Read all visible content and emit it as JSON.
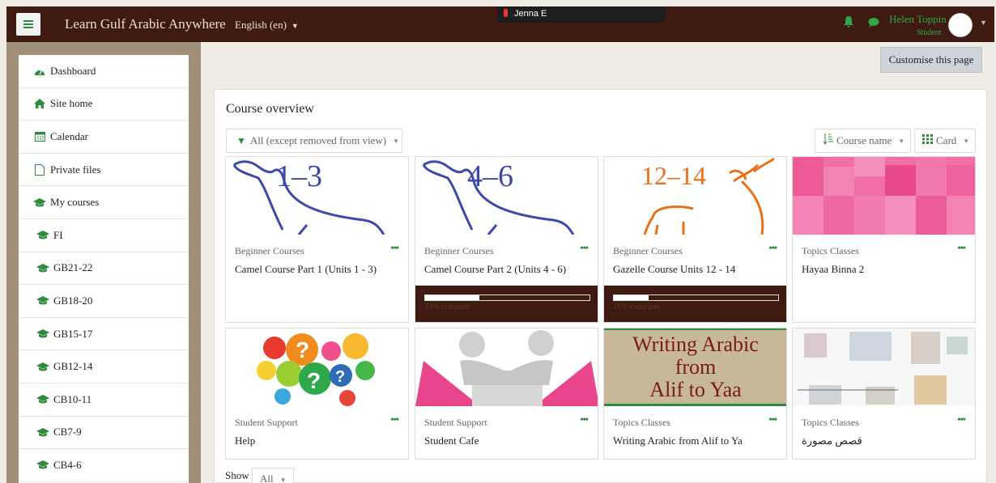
{
  "topbar": {
    "site_title": "Learn Gulf Arabic Anywhere",
    "language": "English (en)",
    "zoom_participant": "Jenna E",
    "user_name": "Helen Toppin",
    "user_role": "Student",
    "icons": [
      "menu-icon",
      "bell-icon",
      "chat-icon",
      "avatar",
      "chevron-down-icon"
    ]
  },
  "nav": {
    "items": [
      {
        "label": "Dashboard",
        "icon": "dashboard-icon"
      },
      {
        "label": "Site home",
        "icon": "home-icon"
      },
      {
        "label": "Calendar",
        "icon": "calendar-icon"
      },
      {
        "label": "Private files",
        "icon": "file-icon"
      },
      {
        "label": "My courses",
        "icon": "graduation-cap-icon"
      },
      {
        "label": "FI",
        "icon": "graduation-cap-icon"
      },
      {
        "label": "GB21-22",
        "icon": "graduation-cap-icon"
      },
      {
        "label": "GB18-20",
        "icon": "graduation-cap-icon"
      },
      {
        "label": "GB15-17",
        "icon": "graduation-cap-icon"
      },
      {
        "label": "GB12-14",
        "icon": "graduation-cap-icon"
      },
      {
        "label": "CB10-11",
        "icon": "graduation-cap-icon"
      },
      {
        "label": "CB7-9",
        "icon": "graduation-cap-icon"
      },
      {
        "label": "CB4-6",
        "icon": "graduation-cap-icon"
      }
    ]
  },
  "header": {
    "customise_label": "Customise this page"
  },
  "overview": {
    "title": "Course overview",
    "filter_label": "All (except removed from view)",
    "sort_label": "Course name",
    "view_label": "Card",
    "show_label": "Show",
    "show_value": "All"
  },
  "courses": [
    {
      "category": "Beginner Courses",
      "name": "Camel Course Part 1 (Units 1 - 3)",
      "image_text": "1–3",
      "progress_text": null
    },
    {
      "category": "Beginner Courses",
      "name": "Camel Course Part 2 (Units 4 - 6)",
      "image_text": "4–6",
      "progress": 0.33,
      "progress_text": "33% complete"
    },
    {
      "category": "Beginner Courses",
      "name": "Gazelle Course Units 12 - 14",
      "image_text": "12–14",
      "progress": 0.21,
      "progress_text": "21% complete"
    },
    {
      "category": "Topics Classes",
      "name": "Hayaa Binna 2",
      "progress_text": null
    },
    {
      "category": "Student Support",
      "name": "Help",
      "progress_text": null
    },
    {
      "category": "Student Support",
      "name": "Student Cafe",
      "progress_text": null
    },
    {
      "category": "Topics Classes",
      "name": "Writing Arabic from Alif to Ya",
      "image_lines": [
        "Writing Arabic",
        "from",
        "Alif to Yaa"
      ],
      "progress_text": null
    },
    {
      "category": "Topics Classes",
      "name": "قصص مصورة",
      "progress_text": null
    }
  ],
  "colors": {
    "topbar": "#3f1a10",
    "accent_green": "#2e8b3d",
    "camel_blue": "#3d4aa8",
    "gazelle_orange": "#e8721c",
    "pink": "#ef5f9c"
  }
}
